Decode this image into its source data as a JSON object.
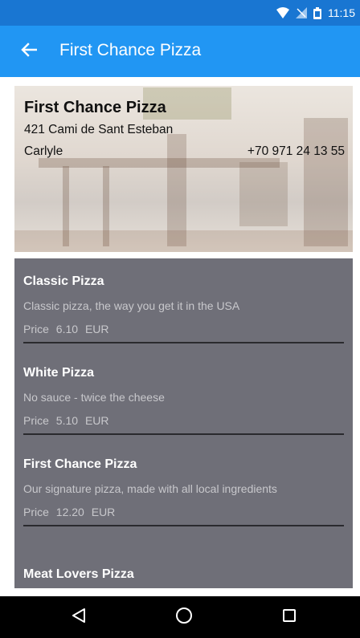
{
  "status_bar": {
    "time": "11:15",
    "icons": [
      "wifi-icon",
      "signal-icon",
      "battery-icon"
    ]
  },
  "app_bar": {
    "back_icon": "arrow-left-icon",
    "title": "First Chance Pizza",
    "color": "#2196f3"
  },
  "restaurant": {
    "name": "First Chance Pizza",
    "address": "421 Cami de Sant Esteban",
    "city": "Carlyle",
    "phone": "+70 971 24 13 55"
  },
  "menu": {
    "items": [
      {
        "name": "Classic Pizza",
        "description": "Classic pizza, the way you get it in the USA",
        "price_label": "Price",
        "price": "6.10",
        "currency": "EUR"
      },
      {
        "name": "White Pizza",
        "description": "No sauce - twice the cheese",
        "price_label": "Price",
        "price": "5.10",
        "currency": "EUR"
      },
      {
        "name": "First Chance Pizza",
        "description": "Our signature pizza, made with all local ingredients",
        "price_label": "Price",
        "price": "12.20",
        "currency": "EUR"
      },
      {
        "name": "Meat Lovers Pizza"
      }
    ]
  },
  "nav_bar": {
    "buttons": [
      "back-triangle-icon",
      "home-circle-icon",
      "recents-square-icon"
    ]
  }
}
